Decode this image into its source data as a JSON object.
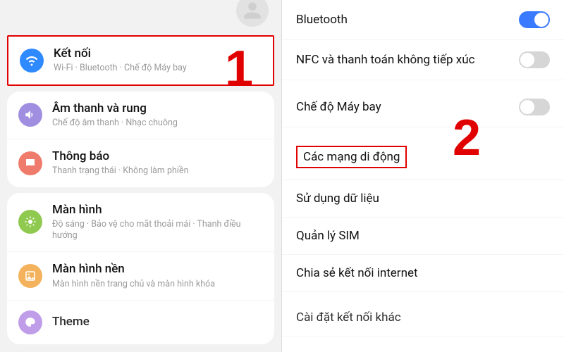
{
  "steps": {
    "one": "1",
    "two": "2"
  },
  "left": {
    "connections": {
      "title": "Kết nối",
      "sub": "Wi-Fi · Bluetooth · Chế độ Máy bay",
      "icon": "wifi-icon",
      "color": "#2f8aff"
    },
    "sound": {
      "title": "Âm thanh và rung",
      "sub": "Chế độ âm thanh · Nhạc chuông",
      "icon": "sound-icon",
      "color": "#a08fe0"
    },
    "notifications": {
      "title": "Thông báo",
      "sub": "Thanh trạng thái · Không làm phiền",
      "icon": "notification-icon",
      "color": "#ef7b6c"
    },
    "display": {
      "title": "Màn hình",
      "sub": "Độ sáng · Bảo vệ cho mắt thoải mái · Thanh điều hướng",
      "icon": "display-icon",
      "color": "#8fc94f"
    },
    "wallpaper": {
      "title": "Màn hình nền",
      "sub": "Màn hình nền trang chủ và màn hình khóa",
      "icon": "wallpaper-icon",
      "color": "#f3b25b"
    },
    "theme": {
      "title": "Theme",
      "sub": "",
      "icon": "theme-icon",
      "color": "#b993e6"
    }
  },
  "right": {
    "bluetooth": {
      "label": "Bluetooth",
      "on": true
    },
    "nfc": {
      "label": "NFC và thanh toán không tiếp xúc",
      "on": false
    },
    "airplane": {
      "label": "Chế độ Máy bay",
      "on": false
    },
    "mobile_networks": {
      "label": "Các mạng di động"
    },
    "data_usage": {
      "label": "Sử dụng dữ liệu"
    },
    "sim": {
      "label": "Quản lý SIM"
    },
    "tethering": {
      "label": "Chia sẻ kết nối internet"
    },
    "more": {
      "label": "Cài đặt kết nối khác"
    }
  }
}
